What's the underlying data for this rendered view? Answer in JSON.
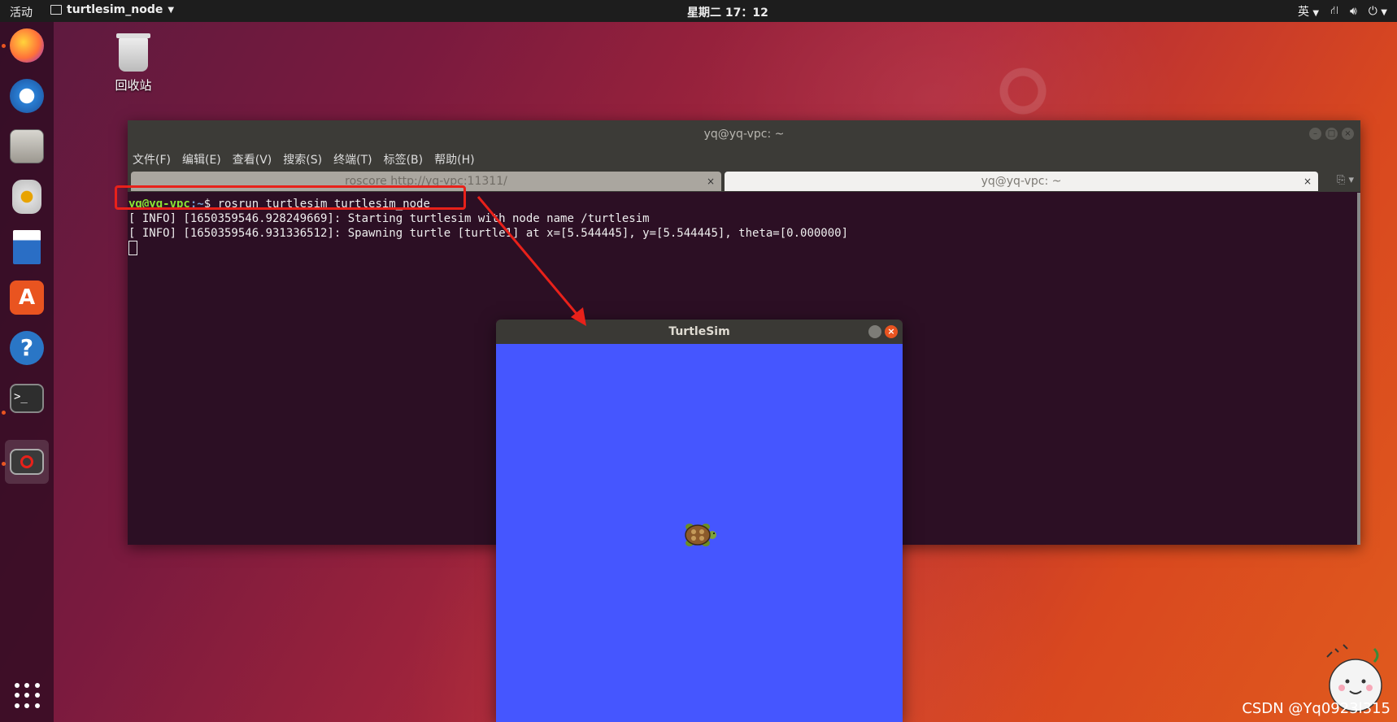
{
  "topbar": {
    "activities": "活动",
    "app_name": "turtlesim_node",
    "clock": "星期二 17：12",
    "input_method": "英"
  },
  "desktop": {
    "trash_label": "回收站"
  },
  "dock": {
    "items": [
      "firefox",
      "thunderbird",
      "files",
      "rhythmbox",
      "writer",
      "software-center",
      "help",
      "terminal",
      "turtlesim"
    ]
  },
  "terminal": {
    "title": "yq@yq-vpc: ~",
    "menu": [
      "文件(F)",
      "编辑(E)",
      "查看(V)",
      "搜索(S)",
      "终端(T)",
      "标签(B)",
      "帮助(H)"
    ],
    "tabs": [
      {
        "label": "roscore http://yq-vpc:11311/",
        "active": false
      },
      {
        "label": "yq@yq-vpc: ~",
        "active": true
      }
    ],
    "prompt_user": "yq@yq-vpc",
    "prompt_path": ":~",
    "prompt_symbol": "$ ",
    "command": "rosrun turtlesim turtlesim_node",
    "output": [
      "[ INFO] [1650359546.928249669]: Starting turtlesim with node name /turtlesim",
      "[ INFO] [1650359546.931336512]: Spawning turtle [turtle1] at x=[5.544445], y=[5.544445], theta=[0.000000]"
    ]
  },
  "turtlesim": {
    "title": "TurtleSim",
    "background_color": "#4556ff"
  },
  "watermark": "CSDN @Yq0923l315"
}
